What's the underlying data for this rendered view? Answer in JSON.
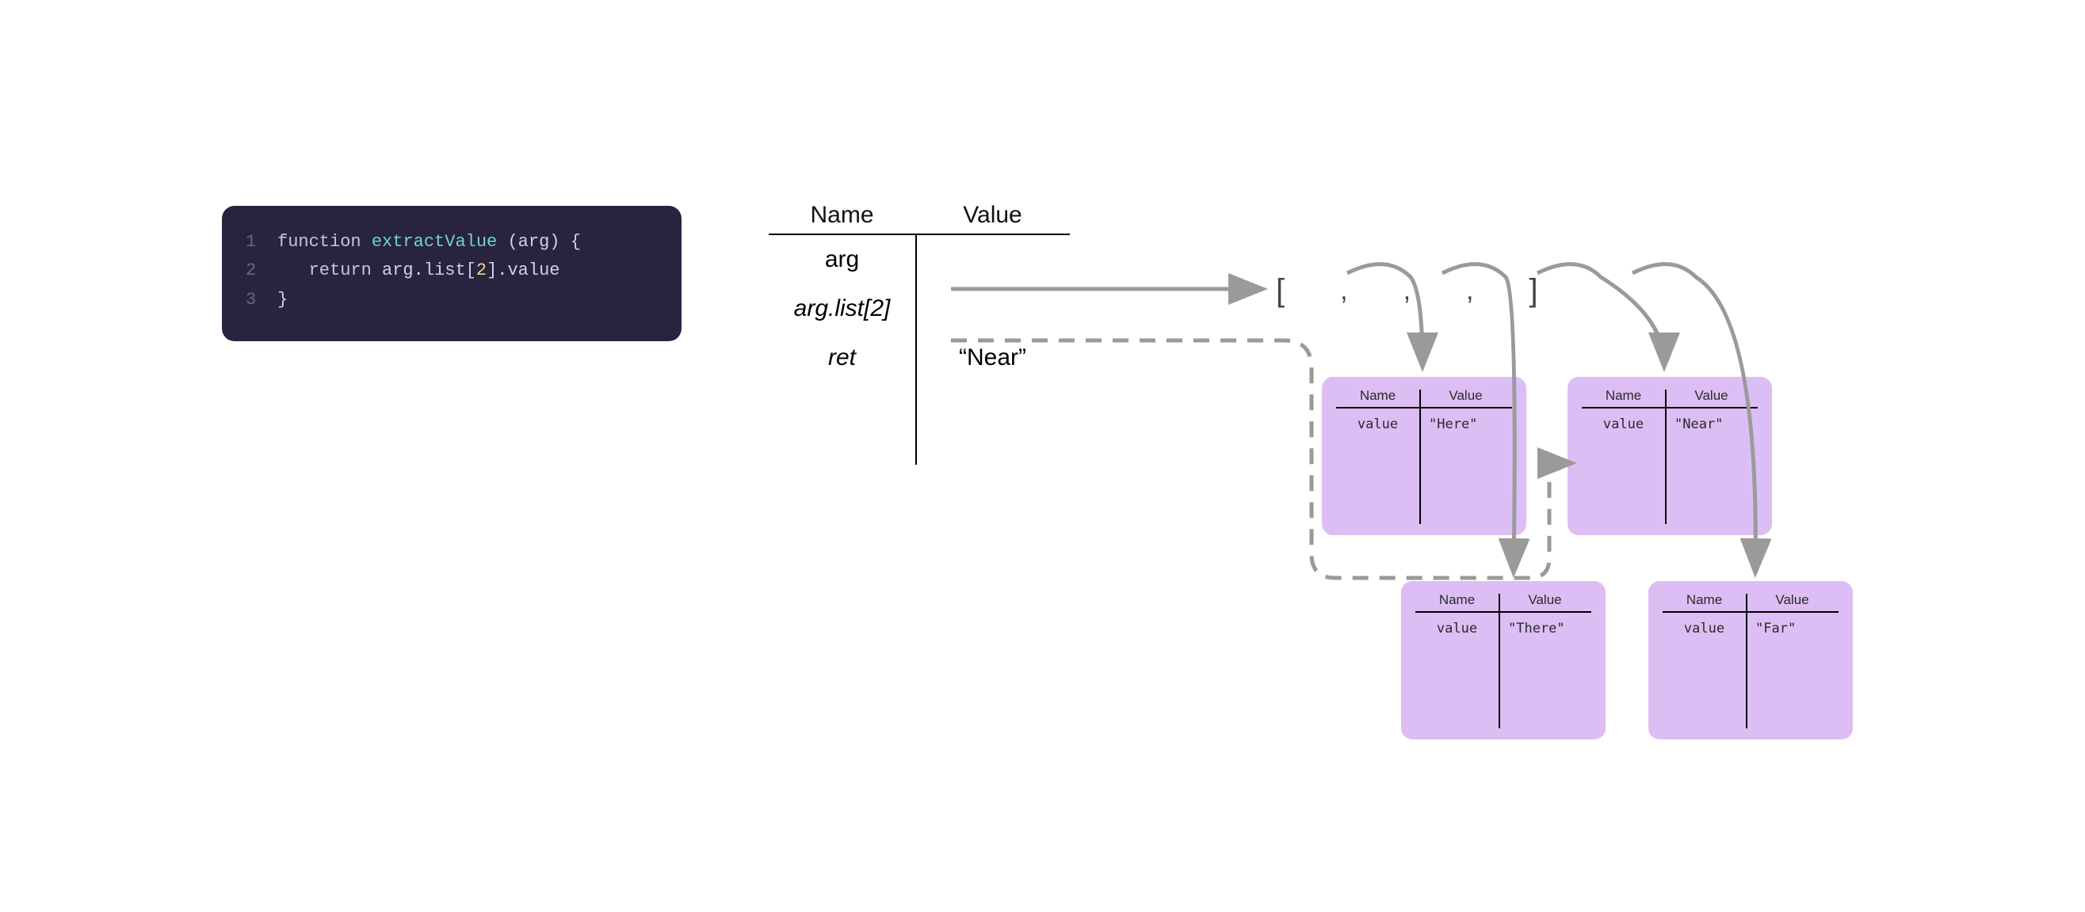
{
  "code": {
    "lines": [
      "1",
      "2",
      "3"
    ],
    "kw_function": "function",
    "fn_name": "extractValue",
    "arg_name": "arg",
    "brace_open": "{",
    "kw_return": "return",
    "expr_arg": "arg",
    "expr_list": "list",
    "expr_index": "2",
    "expr_value": "value",
    "brace_close": "}"
  },
  "nvTable": {
    "head_name": "Name",
    "head_value": "Value",
    "rows": [
      {
        "name": "arg",
        "value": ""
      },
      {
        "name": "arg.list[2]",
        "value": ""
      },
      {
        "name": "ret",
        "value": "“Near”"
      }
    ]
  },
  "arrayLiteral": {
    "open": "[",
    "sep": ",",
    "close": "]"
  },
  "objects": {
    "head_name": "Name",
    "head_value": "Value",
    "key_label": "value",
    "here": "\"Here\"",
    "there": "\"There\"",
    "near": "\"Near\"",
    "far": "\"Far\""
  },
  "colors": {
    "codeBg": "#28233f",
    "objectBg": "#dcbef4",
    "arrow": "#9a9a9a"
  }
}
